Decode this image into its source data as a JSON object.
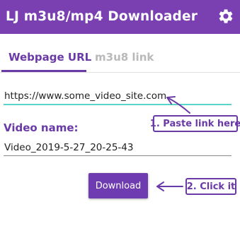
{
  "app": {
    "title": "LJ m3u8/mp4 Downloader",
    "header_color": "#7a40b2",
    "settings_icon": "gear-icon"
  },
  "tabs": [
    {
      "label": "Webpage URL",
      "active": true
    },
    {
      "label": "m3u8 link",
      "active": false
    }
  ],
  "url_field": {
    "value": "https://www.some_video_site.com",
    "underline_color": "#55d6c8"
  },
  "video_name": {
    "label": "Video name:",
    "value": "Video_2019-5-27_20-25-43"
  },
  "download_button": {
    "label": "Download"
  },
  "annotations": {
    "paste": "1. Paste link here",
    "click": "2. Click it"
  },
  "accent_color": "#6a3aa6"
}
